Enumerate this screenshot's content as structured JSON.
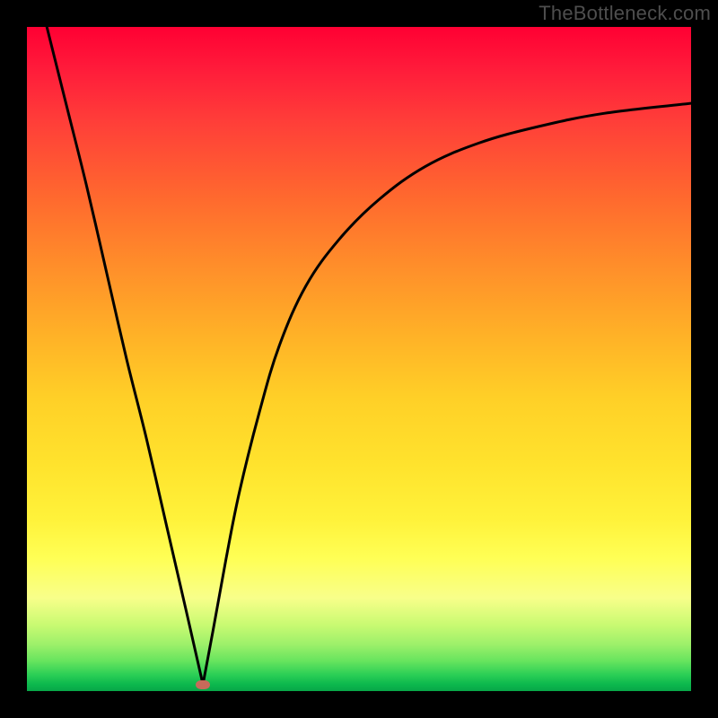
{
  "watermark": "TheBottleneck.com",
  "colors": {
    "page_bg": "#000000",
    "gradient_top": "#ff0033",
    "gradient_bottom": "#08a648",
    "curve_stroke": "#000000",
    "marker_fill": "#c76a5a",
    "watermark_text": "#4e4e4e"
  },
  "chart_data": {
    "type": "line",
    "title": "",
    "xlabel": "",
    "ylabel": "",
    "xlim": [
      0,
      100
    ],
    "ylim": [
      0,
      100
    ],
    "grid": false,
    "legend": false,
    "series": [
      {
        "name": "left-branch",
        "x": [
          3,
          6,
          9,
          12,
          15,
          18,
          21,
          24,
          26.5
        ],
        "y": [
          100,
          88,
          76,
          63,
          50,
          38,
          25,
          12,
          1
        ]
      },
      {
        "name": "right-branch",
        "x": [
          26.5,
          28,
          30,
          32,
          35,
          38,
          42,
          47,
          53,
          60,
          68,
          77,
          87,
          100
        ],
        "y": [
          1,
          9,
          20,
          30,
          42,
          52,
          61,
          68,
          74,
          79,
          82.5,
          85,
          87,
          88.5
        ]
      }
    ],
    "marker": {
      "x": 26.5,
      "y": 1
    },
    "annotations": []
  }
}
